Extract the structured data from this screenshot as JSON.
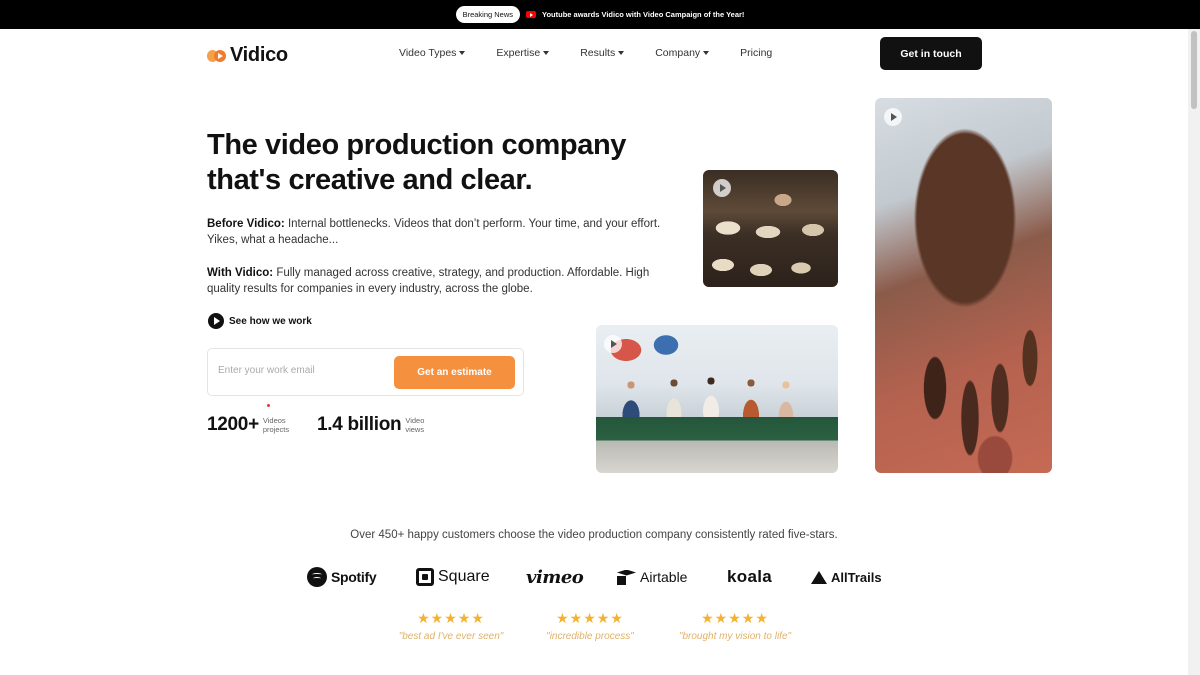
{
  "announcement": {
    "badge": "Breaking News",
    "text": "Youtube awards Vidico with Video Campaign of the Year!",
    "icon": "youtube-icon"
  },
  "header": {
    "logo_text": "Vidico",
    "nav": [
      {
        "label": "Video Types",
        "has_dropdown": true
      },
      {
        "label": "Expertise",
        "has_dropdown": true
      },
      {
        "label": "Results",
        "has_dropdown": true
      },
      {
        "label": "Company",
        "has_dropdown": true
      },
      {
        "label": "Pricing",
        "has_dropdown": false
      }
    ],
    "cta": "Get in touch"
  },
  "hero": {
    "headline": "The video production company that's creative and clear.",
    "before_label": "Before Vidico:",
    "before_text": " Internal bottlenecks. Videos that don’t perform. Your time, and your effort. Yikes, what a headache...",
    "with_label": "With Vidico:",
    "with_text": " Fully managed across creative, strategy, and production. Affordable. High quality results for companies in every industry, across the globe.",
    "how_link": "See how we work",
    "email_placeholder": "Enter your work email",
    "estimate_button": "Get an estimate",
    "stats": [
      {
        "value": "1200+",
        "label": "Videos projects"
      },
      {
        "value": "1.4 billion",
        "label": "Video views"
      }
    ]
  },
  "media": [
    {
      "name": "bakery-video",
      "icon": "play-icon"
    },
    {
      "name": "office-video",
      "icon": "play-icon"
    },
    {
      "name": "hand-video",
      "icon": "play-icon"
    }
  ],
  "customers": {
    "tagline": "Over 450+ happy customers choose the video production company consistently rated five-stars.",
    "logos": [
      "Spotify",
      "Square",
      "vimeo",
      "Airtable",
      "koala",
      "AllTrails"
    ],
    "reviews": [
      {
        "stars": "★★★★★",
        "quote": "\"best ad I've ever seen\""
      },
      {
        "stars": "★★★★★",
        "quote": "\"incredible process\""
      },
      {
        "stars": "★★★★★",
        "quote": "\"brought my vision to life\""
      }
    ]
  },
  "colors": {
    "accent": "#f5913e",
    "dark": "#111111",
    "star": "#f2b233"
  }
}
